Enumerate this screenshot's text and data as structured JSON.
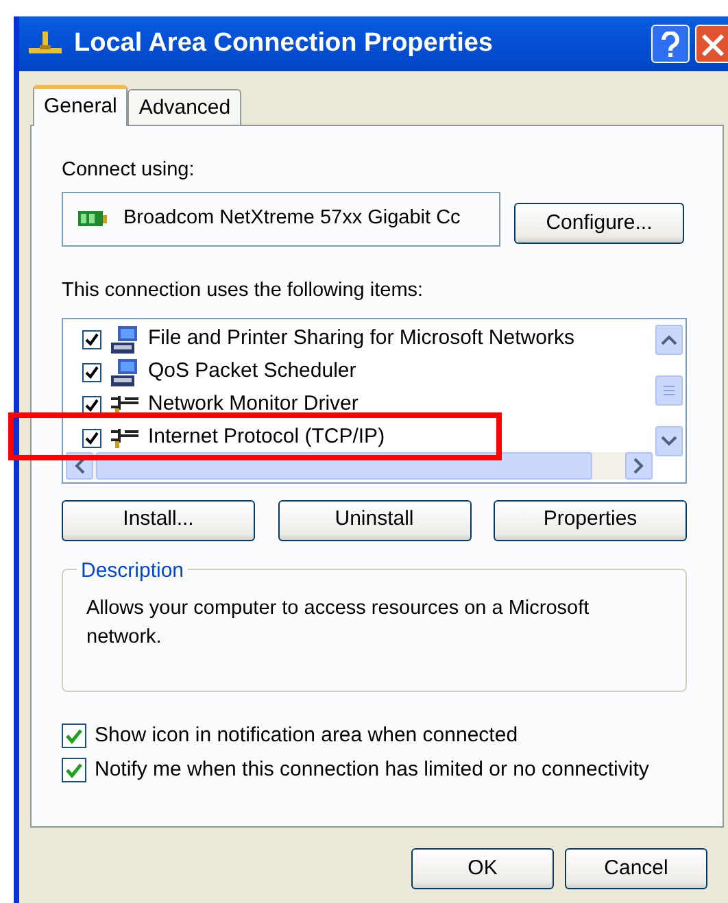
{
  "window": {
    "title": "Local Area Connection Properties"
  },
  "tabs": [
    {
      "label": "General",
      "selected": true
    },
    {
      "label": "Advanced",
      "selected": false
    }
  ],
  "connect_using": {
    "label": "Connect using:",
    "adapter": "Broadcom NetXtreme 57xx Gigabit Cc",
    "button": "Configure..."
  },
  "items_label": "This connection uses the following items:",
  "items": [
    {
      "label": "File and Printer Sharing for Microsoft Networks",
      "checked": true,
      "kind": "service"
    },
    {
      "label": "QoS Packet Scheduler",
      "checked": true,
      "kind": "service"
    },
    {
      "label": "Network Monitor Driver",
      "checked": true,
      "kind": "protocol"
    },
    {
      "label": "Internet Protocol (TCP/IP)",
      "checked": true,
      "kind": "protocol"
    }
  ],
  "item_buttons": [
    "Install...",
    "Uninstall",
    "Properties"
  ],
  "description": {
    "title": "Description",
    "text": "Allows your computer to access resources on a Microsoft network."
  },
  "options": [
    {
      "label": "Show icon in notification area when connected",
      "checked": true
    },
    {
      "label": "Notify me when this connection has limited or no connectivity",
      "checked": true
    }
  ],
  "buttons": [
    "OK",
    "Cancel"
  ]
}
